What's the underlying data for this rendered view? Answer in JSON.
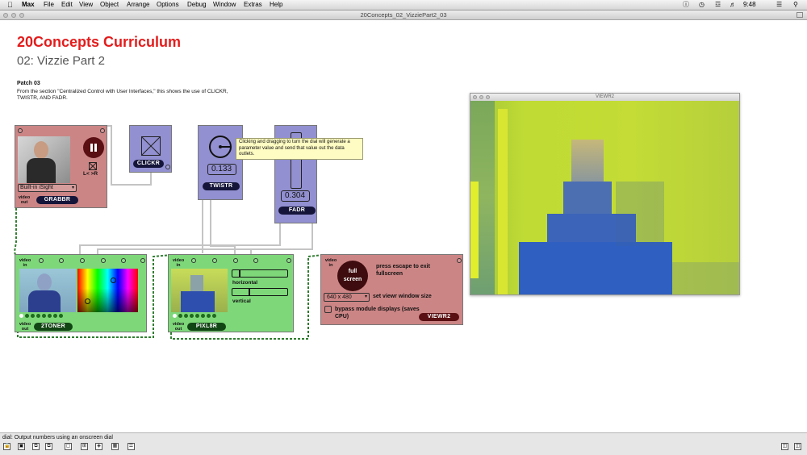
{
  "menubar": {
    "app_name": "Max",
    "items": [
      "File",
      "Edit",
      "View",
      "Object",
      "Arrange",
      "Options",
      "Debug",
      "Window",
      "Extras",
      "Help"
    ],
    "time": "9:48"
  },
  "window": {
    "title": "20Concepts_02_VizziePart2_03"
  },
  "content": {
    "title": "20Concepts Curriculum",
    "subtitle": "02: Vizzie Part 2",
    "patch_number": "Patch 03",
    "description": "From the section \"Centralized Control with User Interfaces,\" this shows the use of CLICKR, TWISTR, AND FADR."
  },
  "grabbr": {
    "label": "GRABBR",
    "source": "Built-in iSight",
    "lr_label": "L< >R",
    "video_out": "video out"
  },
  "clickr": {
    "label": "CLICKR"
  },
  "twistr": {
    "label": "TWISTR",
    "value": "0.133"
  },
  "fadr": {
    "label": "FADR",
    "value": "0.304"
  },
  "tooltip": {
    "text": "Clicking and dragging to turn the dial will generate a parameter value and send that value out the data outlets."
  },
  "toner": {
    "label": "2TONER",
    "video_in": "video in",
    "video_out": "video out"
  },
  "pixl8r": {
    "label": "PIXL8R",
    "video_in": "video in",
    "video_out": "video out",
    "horizontal_label": "horizontal",
    "vertical_label": "vertical"
  },
  "viewr2": {
    "label": "VIEWR2",
    "video_in": "video in",
    "fullscreen_label": "full screen",
    "escape_note": "press escape to exit fullscreen",
    "size_value": "640 x 480",
    "size_label": "set viewr window size",
    "bypass_label": "bypass module displays (saves CPU)"
  },
  "viewr_window": {
    "title": "VIEWR2"
  },
  "statusbar": {
    "text": "dial: Output numbers using an onscreen dial"
  },
  "colors": {
    "title_red": "#e41c1c",
    "pink_module": "#cc8585",
    "purple_module": "#9290d0",
    "green_module": "#7ed87a",
    "tooltip_bg": "#fefcc2"
  }
}
